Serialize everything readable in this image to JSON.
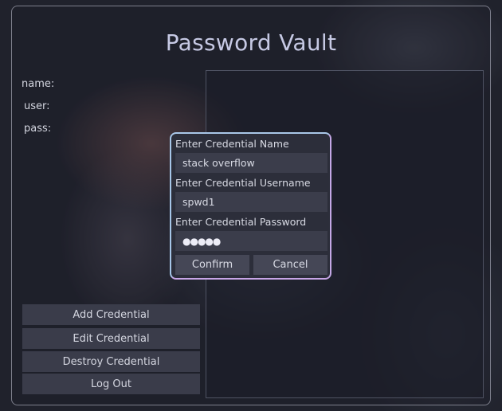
{
  "window": {
    "title": "Password Vault"
  },
  "details": {
    "name_label": "name:",
    "user_label": "user:",
    "pass_label": "pass:"
  },
  "actions": {
    "add": "Add Credential",
    "edit": "Edit Credential",
    "destroy": "Destroy Credential",
    "logout": "Log Out"
  },
  "dialog": {
    "name_label": "Enter Credential Name",
    "name_value": "stack overflow",
    "username_label": "Enter Credential Username",
    "username_value": "spwd1",
    "password_label": "Enter Credential Password",
    "password_value": "●●●●●",
    "confirm": "Confirm",
    "cancel": "Cancel"
  }
}
